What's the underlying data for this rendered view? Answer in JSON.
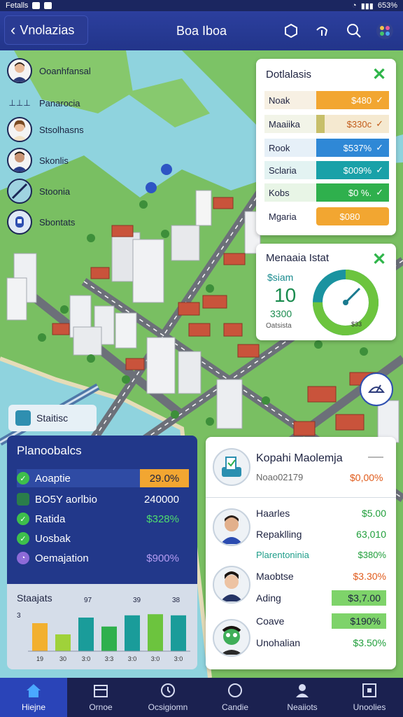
{
  "status_bar": {
    "left": "Fetalls",
    "right": "653%"
  },
  "header": {
    "back_label": "Vnolazias",
    "title": "Boa Iboa"
  },
  "map_people": [
    {
      "label": "Ooanhfansal"
    },
    {
      "label": "Panarocia"
    },
    {
      "label": "Stsolhasns"
    },
    {
      "label": "Skonlis"
    },
    {
      "label": "Stoonia"
    },
    {
      "label": "Sbontats"
    }
  ],
  "map_chip": {
    "label": "Staitisc"
  },
  "details_panel": {
    "title": "Dotlalasis",
    "rows": [
      {
        "label": "Noak",
        "value": "$480",
        "color": "#f2a631"
      },
      {
        "label": "Maaiika",
        "value": "$330c",
        "color": "#c7bf6a"
      },
      {
        "label": "Rook",
        "value": "$537%",
        "color": "#2f88d6"
      },
      {
        "label": "Sclaria",
        "value": "$009%",
        "color": "#19a1a8"
      },
      {
        "label": "Kobs",
        "value": "$0 %.",
        "color": "#2fb04d"
      },
      {
        "label": "Mgaria",
        "value": "$080",
        "color": "#f2a631"
      }
    ]
  },
  "gauge_panel": {
    "title": "Menaaia Istat",
    "label_top": "$siam",
    "big_value": "10",
    "sub_value": "3300",
    "small_label": "Oatsista",
    "gauge_center": "$33",
    "gauge_level": 0.75
  },
  "stats_panel": {
    "title": "Planoobalcs",
    "rows": [
      {
        "label": "Aoaptie",
        "value": "29.0%",
        "icon": "check"
      },
      {
        "label": "BO5Y aorlbio",
        "value": "240000",
        "icon": "none"
      },
      {
        "label": "Ratida",
        "value": "$328%",
        "icon": "check"
      },
      {
        "label": "Uosbak",
        "value": "",
        "icon": "check"
      },
      {
        "label": "Oemajation",
        "value": "$900%",
        "icon": "clock"
      }
    ]
  },
  "mini_chart": {
    "title": "Staajats",
    "top_labels": [
      "97",
      "39",
      "38"
    ],
    "side_label": "3",
    "x_labels": [
      "19",
      "30",
      "3:0",
      "3:3",
      "3:0",
      "3:0",
      "3:0"
    ]
  },
  "chart_data": {
    "type": "bar",
    "title": "Staajats",
    "categories": [
      "19",
      "30",
      "3:0",
      "3:3",
      "3:0",
      "3:0",
      "3:0"
    ],
    "series": [
      {
        "values": [
          2.5,
          1.5,
          3.0,
          2.2,
          3.2,
          3.3,
          3.2
        ]
      }
    ]
  },
  "profile_panel": {
    "name": "Kopahi Maolemja",
    "subtitle": "Noao02179",
    "subtitle_value": "$0,00%",
    "rows": [
      {
        "label": "Haarles",
        "value": "$5.00",
        "value_color": "#1f9e3a",
        "highlight": false
      },
      {
        "label": "Repaklling",
        "value": "63,010",
        "value_color": "#1f9e3a",
        "highlight": false
      },
      {
        "label": "Plarentoninia",
        "value": "$380%",
        "value_color": "#1f9e3a",
        "highlight": false,
        "label_color": "#1f9e8a"
      },
      {
        "label": "Maobtse",
        "value": "$3.30%",
        "value_color": "#e05a1a",
        "highlight": false
      },
      {
        "label": "Ading",
        "value": "$3,7.00",
        "value_color": "#1d2240",
        "highlight": true
      },
      {
        "label": "Coave",
        "value": "$190%",
        "value_color": "#1d2240",
        "highlight": true
      },
      {
        "label": "Unohalian",
        "value": "$3.50%",
        "value_color": "#1f9e3a",
        "highlight": false
      }
    ]
  },
  "nav": [
    {
      "label": "Hiejne",
      "icon": "home-icon",
      "active": true
    },
    {
      "label": "Ornoe",
      "icon": "store-icon",
      "active": false
    },
    {
      "label": "Ocsigiomn",
      "icon": "clock-icon",
      "active": false
    },
    {
      "label": "Candie",
      "icon": "circle-icon",
      "active": false
    },
    {
      "label": "Neaiiots",
      "icon": "person-icon",
      "active": false
    },
    {
      "label": "Unoolies",
      "icon": "square-icon",
      "active": false
    }
  ]
}
